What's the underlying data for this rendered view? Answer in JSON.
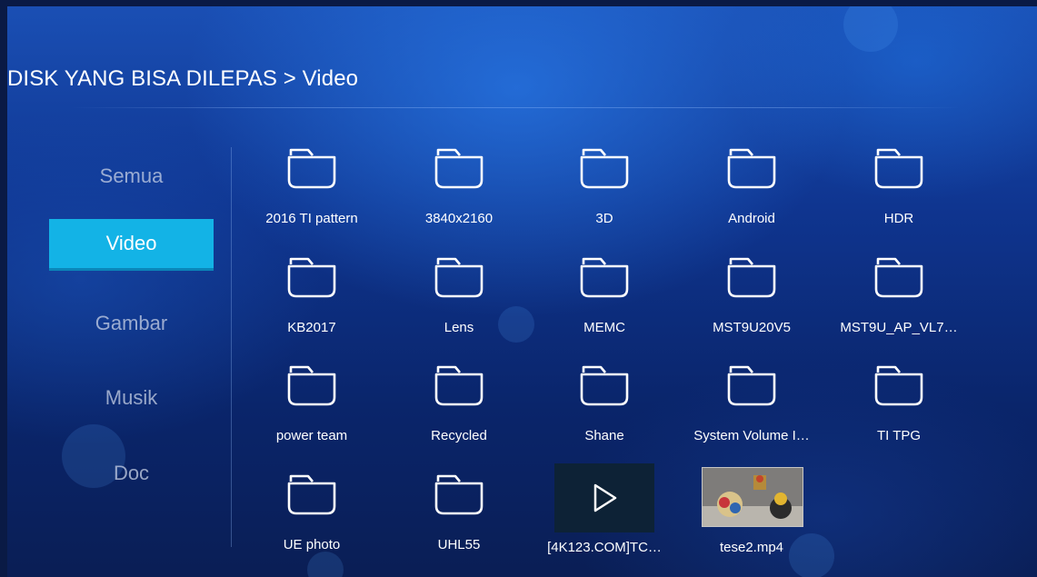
{
  "header": {
    "breadcrumb": "DISK YANG BISA DILEPAS > Video"
  },
  "sidebar": {
    "items": [
      {
        "label": "Semua",
        "active": false
      },
      {
        "label": "Video",
        "active": true
      },
      {
        "label": "Gambar",
        "active": false
      },
      {
        "label": "Musik",
        "active": false
      },
      {
        "label": "Doc",
        "active": false
      }
    ]
  },
  "grid": {
    "folders": [
      {
        "label": "2016 TI pattern",
        "icon": "folder-icon"
      },
      {
        "label": "3840x2160",
        "icon": "folder-icon"
      },
      {
        "label": "3D",
        "icon": "folder-icon"
      },
      {
        "label": "Android",
        "icon": "folder-icon"
      },
      {
        "label": "HDR",
        "icon": "folder-icon"
      },
      {
        "label": "KB2017",
        "icon": "folder-icon"
      },
      {
        "label": "Lens",
        "icon": "folder-icon"
      },
      {
        "label": "MEMC",
        "icon": "folder-icon"
      },
      {
        "label": "MST9U20V5",
        "icon": "folder-icon"
      },
      {
        "label": "MST9U_AP_VL7…",
        "icon": "folder-icon"
      },
      {
        "label": "power team",
        "icon": "folder-icon"
      },
      {
        "label": "Recycled",
        "icon": "folder-icon"
      },
      {
        "label": "Shane",
        "icon": "folder-icon"
      },
      {
        "label": "System Volume I…",
        "icon": "folder-icon"
      },
      {
        "label": "TI TPG",
        "icon": "folder-icon"
      },
      {
        "label": "UE photo",
        "icon": "folder-icon"
      },
      {
        "label": "UHL55",
        "icon": "folder-icon"
      }
    ],
    "files": [
      {
        "label": "[4K123.COM]TC…",
        "icon": "play-icon"
      },
      {
        "label": "tese2.mp4",
        "icon": "video-thumbnail"
      }
    ]
  },
  "colors": {
    "accent": "#13b3e6",
    "text": "#ffffff",
    "inactive": "#c8d2e6"
  }
}
